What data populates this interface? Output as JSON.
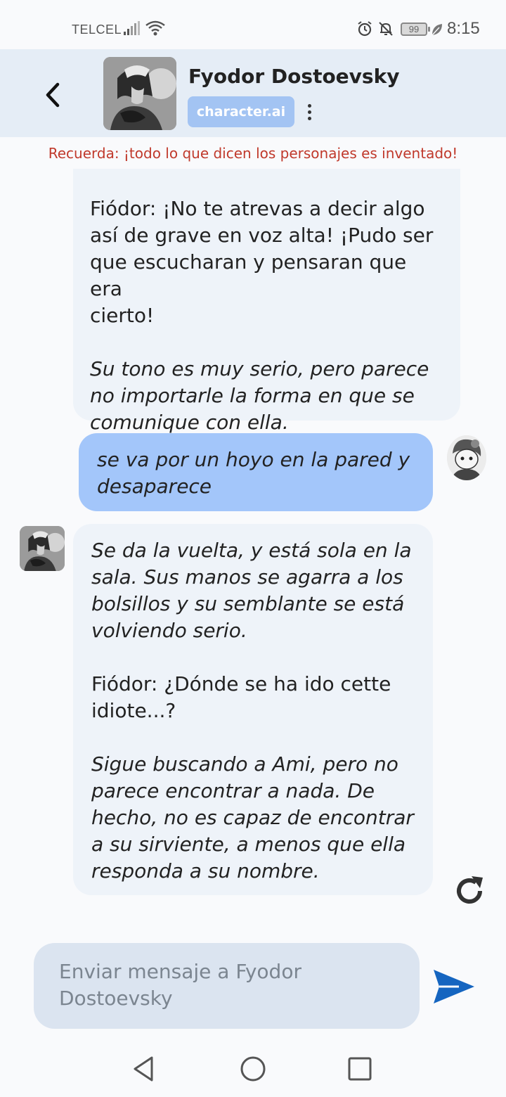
{
  "status_bar": {
    "carrier": "TELCEL",
    "battery": "99",
    "time": "8:15",
    "icons": [
      "signal-icon",
      "wifi-icon",
      "alarm-icon",
      "bell-off-icon",
      "battery-icon",
      "leaf-icon"
    ]
  },
  "header": {
    "character_name": "Fyodor Dostoevsky",
    "brand_label": "character.ai",
    "back_icon": "chevron-left-icon",
    "menu_icon": "more-vertical-icon"
  },
  "disclaimer": "Recuerda: ¡todo lo que dicen los personajes es inventado!",
  "messages": [
    {
      "sender": "bot",
      "paragraphs": [
        {
          "text": "Fiódor: ¡No te atrevas a decir algo\nasí de grave en voz alta! ¡Pudo ser\nque escucharan y pensaran que era\ncierto!",
          "italic": false
        },
        {
          "text": "Su tono es muy serio, pero parece\nno importarle la forma en que se\ncomunique con ella.",
          "italic": true
        }
      ]
    },
    {
      "sender": "user",
      "paragraphs": [
        {
          "text": "se va por un hoyo en la pared y\ndesaparece",
          "italic": true
        }
      ]
    },
    {
      "sender": "bot",
      "paragraphs": [
        {
          "text": "Se da la vuelta, y está sola en la\nsala. Sus manos se agarra a los\nbolsillos y su semblante se está\nvolviendo serio.",
          "italic": true
        },
        {
          "text": "Fiódor: ¿Dónde se ha ido cette\nidiote...?",
          "italic": false
        },
        {
          "text": "Sigue buscando a Ami, pero no\nparece encontrar a nada. De\nhecho, no es capaz de encontrar\na su sirviente, a menos que ella\nresponda a su nombre.",
          "italic": true
        }
      ]
    }
  ],
  "composer": {
    "placeholder": "Enviar mensaje a Fyodor\nDostoevsky",
    "send_icon": "send-icon"
  },
  "nav_bar": {
    "icons": [
      "nav-back-icon",
      "nav-home-icon",
      "nav-recents-icon"
    ]
  },
  "colors": {
    "header_bg": "#e5edf6",
    "brand_badge": "#a3c4f3",
    "bot_bubble": "#eef3f9",
    "user_bubble": "#a3c6fa",
    "disclaimer": "#c0392b",
    "send_button": "#1565c0"
  }
}
